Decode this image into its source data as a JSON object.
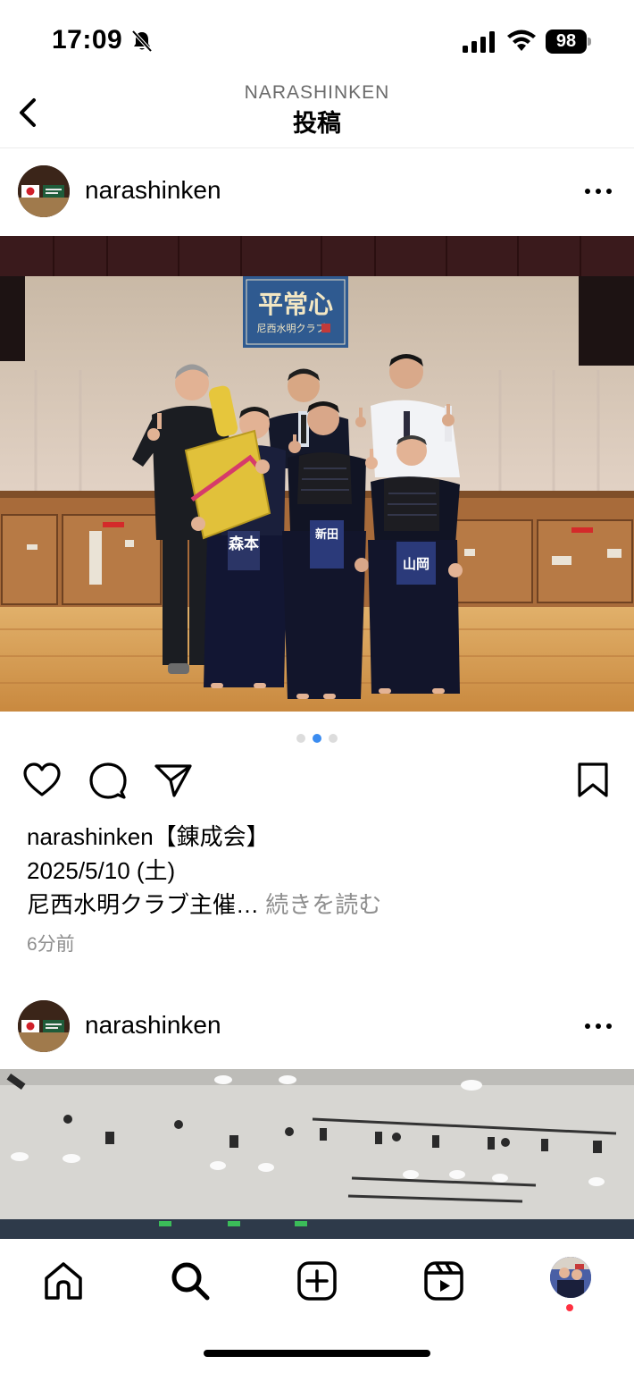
{
  "status_bar": {
    "time": "17:09",
    "battery": "98"
  },
  "header": {
    "account": "NARASHINKEN",
    "title": "投稿"
  },
  "posts": [
    {
      "username": "narashinken",
      "photo": {
        "banner_title": "平常心",
        "banner_subtitle": "尼西水明クラブ",
        "bib_labels": [
          "森本",
          "新田",
          "山岡"
        ]
      },
      "carousel": {
        "count": 3,
        "active_index": 1
      },
      "caption": {
        "username": "narashinken",
        "line1": "【錬成会】",
        "line2": "2025/5/10 (土)",
        "line3": "尼西水明クラブ主催…",
        "more_link": "続きを読む"
      },
      "time_ago": "6分前"
    },
    {
      "username": "narashinken"
    }
  ],
  "tab_bar": {
    "tabs": [
      "home-icon",
      "search-icon",
      "create-icon",
      "reels-icon",
      "profile-avatar"
    ],
    "notification_dot_color": "#ff3040"
  },
  "colors": {
    "active_dot": "#3b8cf0",
    "secondary_text": "#8e8e8e"
  }
}
